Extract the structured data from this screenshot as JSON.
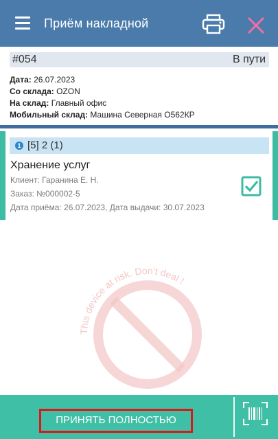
{
  "appbar": {
    "title": "Приём накладной",
    "icons": {
      "menu": "menu-icon",
      "print": "printer-icon",
      "close": "close-icon"
    },
    "color": "#4a7bab"
  },
  "document": {
    "number": "#054",
    "status": "В пути",
    "date_label": "Дата:",
    "date_value": "26.07.2023",
    "from_label": "Со склада:",
    "from_value": "OZON",
    "to_label": "На склад:",
    "to_value": "Главный офис",
    "mobile_label": "Мобильный склад:",
    "mobile_value": "Машина Северная О562КР"
  },
  "item": {
    "index": "1",
    "code": "[5] 2 (1)",
    "name": "Хранение услуг",
    "client": "Клиент: Гаранина Е. Н.",
    "order": "Заказ: №000002-5",
    "dates": "Дата приёма: 26.07.2023, Дата выдачи: 30.07.2023",
    "checked": true,
    "accent_color": "#3dbba3"
  },
  "watermark": {
    "text": "This device at risk. Don't deal !"
  },
  "bottom": {
    "accept_label": "ПРИНЯТЬ ПОЛНОСТЬЮ",
    "scan_icon": "barcode-scan-icon",
    "color": "#3fbfa6"
  }
}
